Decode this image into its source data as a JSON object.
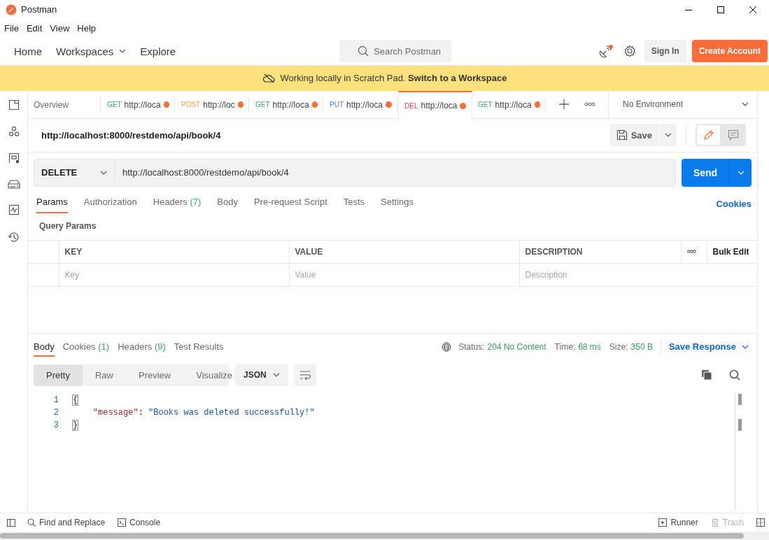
{
  "window": {
    "title": "Postman"
  },
  "menu": [
    "File",
    "Edit",
    "View",
    "Help"
  ],
  "nav": {
    "items": [
      {
        "label": "Home",
        "dropdown": false
      },
      {
        "label": "Workspaces",
        "dropdown": true
      },
      {
        "label": "Explore",
        "dropdown": false
      }
    ],
    "search": {
      "placeholder": "Search Postman"
    },
    "notification": true,
    "sign_in": "Sign In",
    "create_account": "Create Account"
  },
  "banner": {
    "text": "Working locally in Scratch Pad.",
    "link": "Switch to a Workspace"
  },
  "tabs": [
    {
      "kind": "overview",
      "label": "Overview",
      "selected": false
    },
    {
      "kind": "request",
      "method": "GET",
      "color": "#3fa86b",
      "label": "http://loca",
      "unsaved": true,
      "selected": false
    },
    {
      "kind": "request",
      "method": "POST",
      "color": "#f0a24a",
      "label": "http://loc",
      "unsaved": true,
      "selected": false
    },
    {
      "kind": "request",
      "method": "GET",
      "color": "#3fa86b",
      "label": "http://loca",
      "unsaved": true,
      "selected": false
    },
    {
      "kind": "request",
      "method": "PUT",
      "color": "#4a7de8",
      "label": "http://loca",
      "unsaved": true,
      "selected": false
    },
    {
      "kind": "request",
      "method": "DEL",
      "color": "#e0406a",
      "label": "http://loca",
      "unsaved": true,
      "selected": true
    },
    {
      "kind": "request",
      "method": "GET",
      "color": "#3fa86b",
      "label": "http://loca",
      "unsaved": true,
      "selected": false
    }
  ],
  "environment": "No Environment",
  "request": {
    "name": "http://localhost:8000/restdemo/api/book/4",
    "save": "Save",
    "side_toggle": [
      {
        "kind": "edit",
        "selected": true
      },
      {
        "kind": "comments",
        "selected": false
      }
    ],
    "method": "DELETE",
    "url": "http://localhost:8000/restdemo/api/book/4",
    "send": "Send"
  },
  "request_tabs": [
    {
      "label": "Params",
      "selected": true
    },
    {
      "label": "Authorization",
      "selected": false
    },
    {
      "label": "Headers",
      "count": "(7)",
      "selected": false
    },
    {
      "label": "Body",
      "selected": false
    },
    {
      "label": "Pre-request Script",
      "selected": false
    },
    {
      "label": "Tests",
      "selected": false
    },
    {
      "label": "Settings",
      "selected": false
    }
  ],
  "cookies_link": "Cookies",
  "query_params": {
    "title": "Query Params",
    "columns": [
      "KEY",
      "VALUE",
      "DESCRIPTION"
    ],
    "bulk_edit": "Bulk Edit",
    "placeholders": [
      "Key",
      "Value",
      "Description"
    ]
  },
  "response": {
    "tabs": [
      {
        "label": "Body",
        "selected": true
      },
      {
        "label": "Cookies",
        "count": "(1)",
        "selected": false
      },
      {
        "label": "Headers",
        "count": "(9)",
        "selected": false
      },
      {
        "label": "Test Results",
        "selected": false
      }
    ],
    "status": {
      "label": "Status:",
      "value": "204 No Content"
    },
    "time": {
      "label": "Time:",
      "value": "68 ms"
    },
    "size": {
      "label": "Size:",
      "value": "350 B"
    },
    "save_response": "Save Response",
    "views": [
      {
        "label": "Pretty",
        "selected": true
      },
      {
        "label": "Raw",
        "selected": false
      },
      {
        "label": "Preview",
        "selected": false
      },
      {
        "label": "Visualize",
        "selected": false
      }
    ],
    "format": "JSON",
    "lines": [
      {
        "number": "1",
        "tokens": [
          {
            "kind": "brace",
            "text": "{",
            "matched": true
          }
        ]
      },
      {
        "number": "2",
        "tokens": [
          {
            "kind": "key",
            "text": "    \"message\""
          },
          {
            "kind": "punct",
            "text": ": "
          },
          {
            "kind": "string",
            "text": "\"Books was deleted successfully!\""
          }
        ]
      },
      {
        "number": "3",
        "tokens": [
          {
            "kind": "brace",
            "text": "}",
            "matched": true
          }
        ]
      }
    ]
  },
  "status_bar": {
    "left": [
      {
        "kind": "find",
        "label": "Find and Replace"
      },
      {
        "kind": "console",
        "label": "Console"
      }
    ],
    "right": [
      {
        "kind": "runner",
        "label": "Runner",
        "disabled": false
      },
      {
        "kind": "trash",
        "label": "Trash",
        "disabled": true
      }
    ]
  }
}
